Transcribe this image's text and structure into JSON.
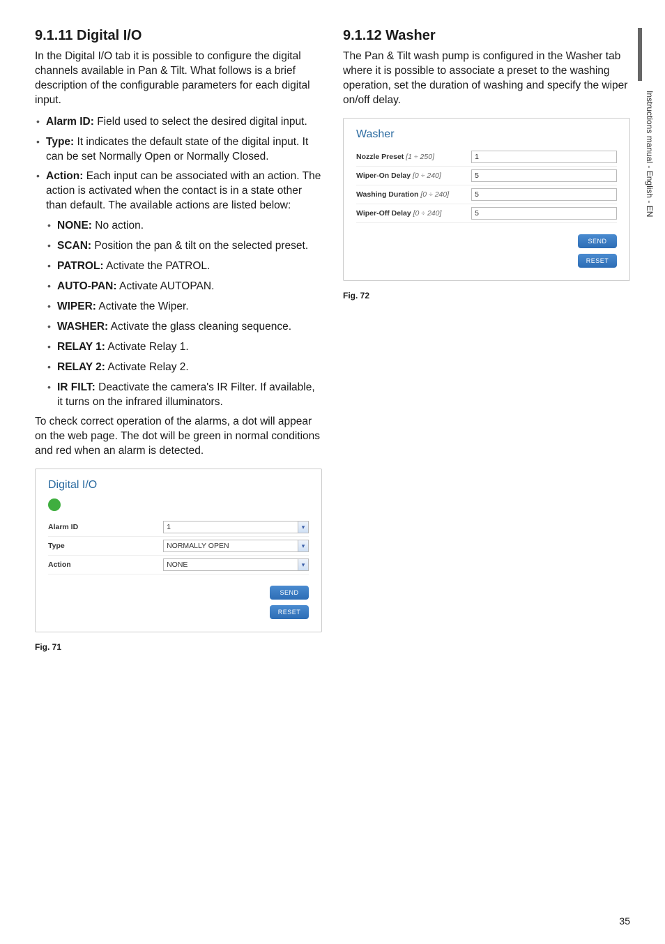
{
  "left": {
    "heading": "9.1.11 Digital I/O",
    "intro": "In the Digital I/O tab it is possible to configure the digital channels available in Pan & Tilt. What follows is a brief description of the configurable parameters for each digital input.",
    "items": [
      {
        "term": "Alarm ID:",
        "desc": " Field used to select the desired digital input."
      },
      {
        "term": "Type:",
        "desc": " It indicates the default state of the digital input. It can be set Normally Open or Normally Closed."
      },
      {
        "term": "Action:",
        "desc": " Each input can be associated with an action. The action is activated when the contact is in a state other than default. The available actions are listed below:"
      }
    ],
    "subitems": [
      {
        "term": "NONE:",
        "desc": " No action."
      },
      {
        "term": "SCAN:",
        "desc": " Position the pan & tilt on the selected preset."
      },
      {
        "term": "PATROL:",
        "desc": " Activate the PATROL."
      },
      {
        "term": "AUTO-PAN:",
        "desc": " Activate AUTOPAN."
      },
      {
        "term": "WIPER:",
        "desc": " Activate the Wiper."
      },
      {
        "term": "WASHER:",
        "desc": " Activate the glass cleaning sequence."
      },
      {
        "term": "RELAY 1:",
        "desc": " Activate Relay 1."
      },
      {
        "term": "RELAY 2:",
        "desc": " Activate Relay 2."
      },
      {
        "term": "IR FILT:",
        "desc": " Deactivate the camera's IR Filter. If available, it turns on the infrared illuminators."
      }
    ],
    "outro": "To check correct operation of the alarms, a dot will appear on the web page. The dot will be green in normal conditions and red when an alarm is detected.",
    "panel": {
      "title": "Digital I/O",
      "rows": [
        {
          "label": "Alarm ID",
          "value": "1",
          "type": "select"
        },
        {
          "label": "Type",
          "value": "NORMALLY OPEN",
          "type": "select"
        },
        {
          "label": "Action",
          "value": "NONE",
          "type": "select"
        }
      ],
      "send": "SEND",
      "reset": "RESET"
    },
    "fig": "Fig. 71"
  },
  "right": {
    "heading": "9.1.12 Washer",
    "intro": "The Pan & Tilt wash pump is configured in the Washer tab where it is possible to associate a preset to the washing operation, set the duration of washing and specify the wiper on/off delay.",
    "panel": {
      "title": "Washer",
      "rows": [
        {
          "label": "Nozzle Preset ",
          "range": "[1 ÷ 250]",
          "value": "1"
        },
        {
          "label": "Wiper-On Delay ",
          "range": "[0 ÷ 240]",
          "value": "5"
        },
        {
          "label": "Washing Duration ",
          "range": "[0 ÷ 240]",
          "value": "5"
        },
        {
          "label": "Wiper-Off Delay ",
          "range": "[0 ÷ 240]",
          "value": "5"
        }
      ],
      "send": "SEND",
      "reset": "RESET"
    },
    "fig": "Fig. 72"
  },
  "side": "Instructions manual - English - EN",
  "page": "35"
}
